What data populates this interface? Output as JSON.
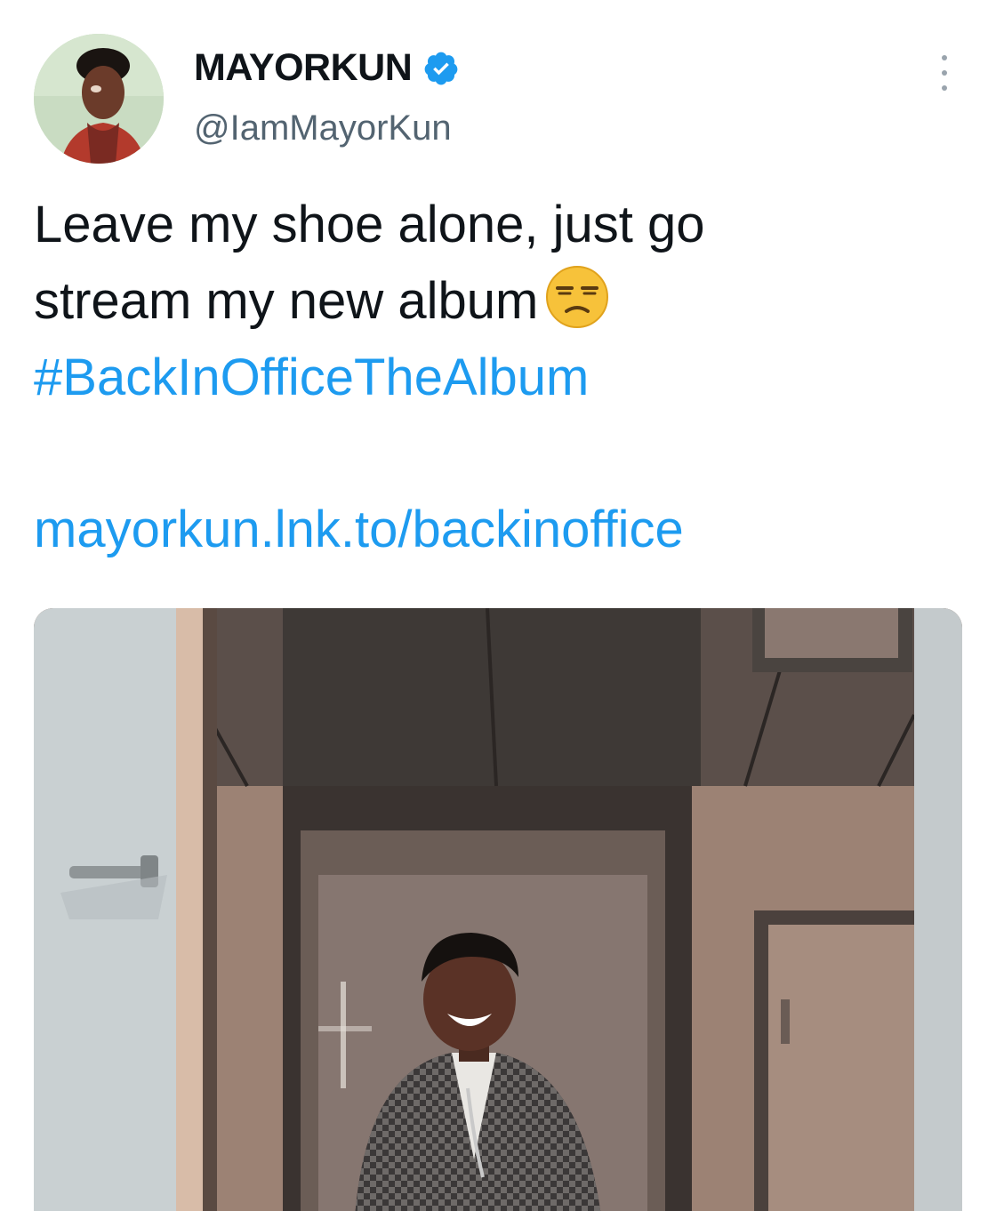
{
  "author": {
    "display_name": "MAYORKUN",
    "handle": "@IamMayorKun",
    "verified": true,
    "avatar_icon": "avatar-photo"
  },
  "tweet": {
    "line1": "Leave my shoe alone, just go",
    "line2": "stream my new album",
    "emoji": "unamused-face-emoji",
    "hashtag": "#BackInOfficeTheAlbum",
    "link": "mayorkun.lnk.to/backinoffice"
  },
  "media": {
    "type": "photo",
    "description_icon": "tweet-photo"
  },
  "colors": {
    "link": "#1d9bf0",
    "verified": "#1d9bf0",
    "text": "#0f1419",
    "secondary": "#536471"
  }
}
